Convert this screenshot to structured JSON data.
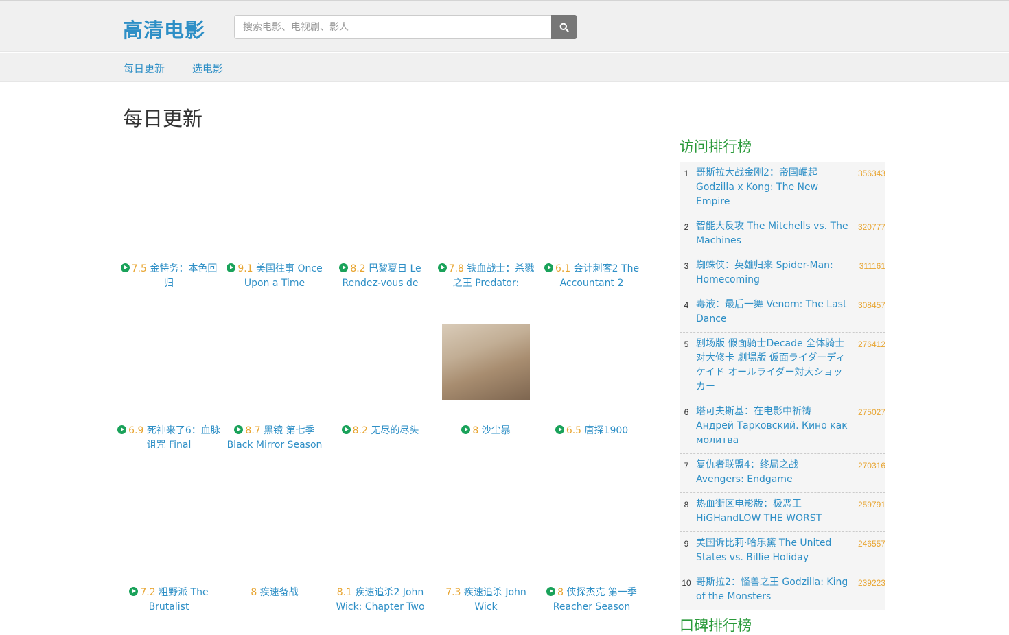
{
  "header": {
    "logo": "高清电影",
    "search_placeholder": "搜索电影、电视剧、影人"
  },
  "nav": [
    {
      "label": "每日更新"
    },
    {
      "label": "选电影"
    }
  ],
  "page_title": "每日更新",
  "movies": [
    {
      "score": "7.5",
      "title": "金特务：本色回归",
      "play": true
    },
    {
      "score": "9.1",
      "title": "美国往事 Once Upon a Time",
      "play": true
    },
    {
      "score": "8.2",
      "title": "巴黎夏日 Le Rendez-vous de",
      "play": true
    },
    {
      "score": "7.8",
      "title": "铁血战士：杀戮之王 Predator:",
      "play": true
    },
    {
      "score": "6.1",
      "title": "会计刺客2 The Accountant 2",
      "play": true
    },
    {
      "score": "6.9",
      "title": "死神来了6：血脉诅咒 Final",
      "play": true
    },
    {
      "score": "8.7",
      "title": "黑镜 第七季 Black Mirror Season",
      "play": true
    },
    {
      "score": "8.2",
      "title": "无尽的尽头",
      "play": true
    },
    {
      "score": "8",
      "title": "沙尘暴",
      "play": true
    },
    {
      "score": "6.5",
      "title": "唐探1900",
      "play": true
    },
    {
      "score": "7.2",
      "title": "粗野派 The Brutalist",
      "play": true
    },
    {
      "score": "8",
      "title": "疾速备战",
      "play": false
    },
    {
      "score": "8.1",
      "title": "疾速追杀2 John Wick: Chapter Two",
      "play": false
    },
    {
      "score": "7.3",
      "title": "疾速追杀 John Wick",
      "play": false
    },
    {
      "score": "8",
      "title": "侠探杰克 第一季 Reacher Season",
      "play": true
    }
  ],
  "sidebar": {
    "visits_title": "访问排行榜",
    "visits": [
      {
        "rank": "1",
        "name": "哥斯拉大战金刚2：帝国崛起 Godzilla x Kong: The New Empire",
        "count": "356343"
      },
      {
        "rank": "2",
        "name": "智能大反攻 The Mitchells vs. The Machines",
        "count": "320777"
      },
      {
        "rank": "3",
        "name": "蜘蛛侠：英雄归来 Spider-Man: Homecoming",
        "count": "311161"
      },
      {
        "rank": "4",
        "name": "毒液：最后一舞 Venom: The Last Dance",
        "count": "308457"
      },
      {
        "rank": "5",
        "name": "剧场版 假面骑士Decade 全体骑士对大修卡 劇場版 仮面ライダーディケイド オールライダー対大ショッカー",
        "count": "276412"
      },
      {
        "rank": "6",
        "name": "塔可夫斯基：在电影中祈祷 Андрей Тарковский. Кино как молитва",
        "count": "275027"
      },
      {
        "rank": "7",
        "name": "复仇者联盟4：终局之战 Avengers: Endgame",
        "count": "270316"
      },
      {
        "rank": "8",
        "name": "热血街区电影版：极恶王 HiGHandLOW THE WORST",
        "count": "259791"
      },
      {
        "rank": "9",
        "name": "美国诉比莉·哈乐黛 The United States vs. Billie Holiday",
        "count": "246557"
      },
      {
        "rank": "10",
        "name": "哥斯拉2：怪兽之王 Godzilla: King of the Monsters",
        "count": "239223"
      }
    ],
    "praise_title": "口碑排行榜"
  }
}
